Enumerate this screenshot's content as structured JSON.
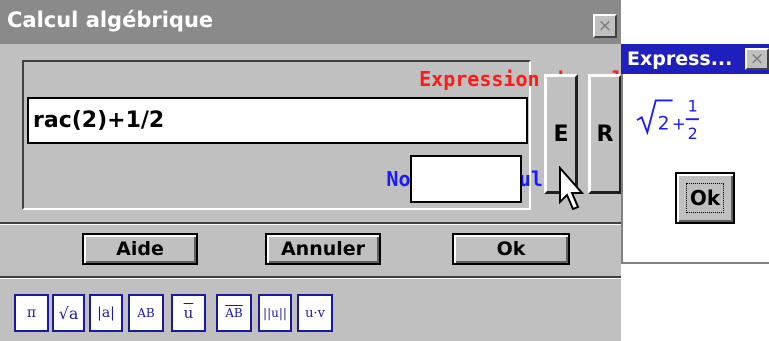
{
  "dialog": {
    "title": "Calcul algébrique",
    "close_glyph": "×",
    "expression_label": "Expression du calcul:",
    "expression_value": "rac(2)+1/2",
    "name_label": "Nom du calcul:",
    "name_value": "",
    "side_buttons": {
      "e": "E",
      "r": "R"
    },
    "buttons": {
      "help": "Aide",
      "cancel": "Annuler",
      "ok": "Ok"
    },
    "toolbar": [
      "π",
      "√a",
      "|a|",
      "AB",
      "u",
      "AB",
      "||u||",
      "u·v"
    ]
  },
  "preview": {
    "title": "Express...",
    "close_glyph": "×",
    "formula": {
      "radicand": "2",
      "plus": "+",
      "numerator": "1",
      "denominator": "2"
    },
    "ok": "Ok"
  },
  "colors": {
    "expression_label": "#ff1a1a",
    "name_label": "#1a1aff",
    "preview_titlebar": "#1f1fbd"
  }
}
